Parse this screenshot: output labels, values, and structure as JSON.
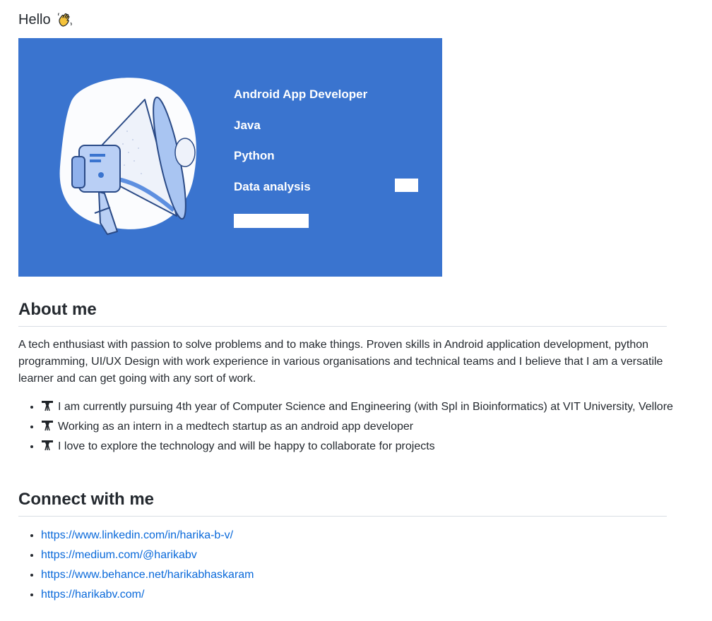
{
  "header": {
    "greeting": "Hello",
    "greeting_emoji": "waving-hand-icon"
  },
  "banner": {
    "background_color": "#3a74cf",
    "illustration": "megaphone-icon",
    "skills": [
      "Android App Developer",
      "Java",
      "Python",
      "Data analysis"
    ]
  },
  "about": {
    "heading": "About me",
    "paragraph": "A tech enthusiast with passion to solve problems and to make things. Proven skills in Android application development, python programming, UI/UX Design with work experience in various organisations and technical teams and I believe that I am a versatile learner and can get going with any sort of work.",
    "bullet_icon": "telescope-icon",
    "bullets": [
      "I am currently pursuing 4th year of Computer Science and Engineering (with Spl in Bioinformatics) at VIT University, Vellore",
      "Working as an intern in a medtech startup as an android app developer",
      "I love to explore the technology and will be happy to collaborate for projects"
    ]
  },
  "connect": {
    "heading": "Connect with me",
    "links": [
      "https://www.linkedin.com/in/harika-b-v/",
      "https://medium.com/@harikabv",
      "https://www.behance.net/harikabhaskaram",
      "https://harikabv.com/"
    ]
  },
  "colors": {
    "link": "#0969da",
    "text": "#24292f",
    "divider": "#d8dee4"
  }
}
